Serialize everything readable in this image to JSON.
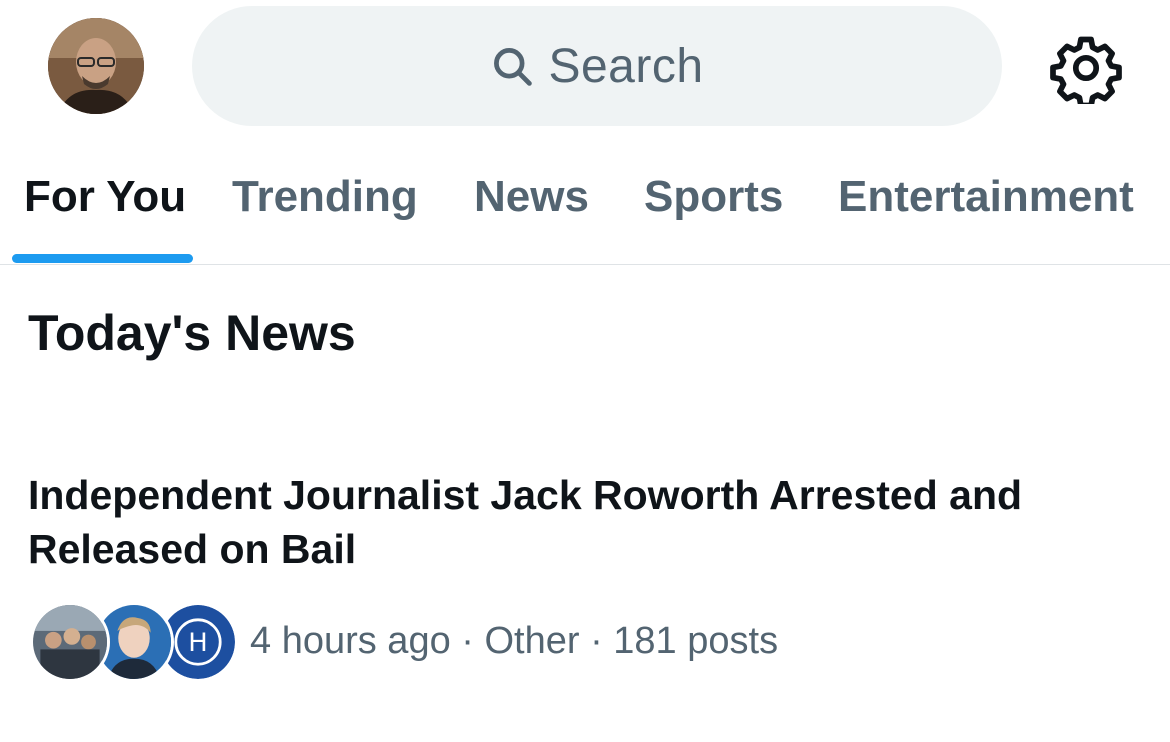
{
  "header": {
    "avatar_icon": "profile-avatar",
    "search": {
      "placeholder": "Search",
      "icon": "search-icon"
    },
    "settings_icon": "gear-icon"
  },
  "tabs": [
    {
      "label": "For You",
      "active": true
    },
    {
      "label": "Trending",
      "active": false
    },
    {
      "label": "News",
      "active": false
    },
    {
      "label": "Sports",
      "active": false
    },
    {
      "label": "Entertainment",
      "active": false
    }
  ],
  "section": {
    "title": "Today's News"
  },
  "news_item": {
    "headline": "Independent Journalist Jack Roworth Arrested and Released on Bail",
    "meta": "4 hours ago · Other · 181 posts",
    "avatars": [
      "group-photo-avatar",
      "man-portrait-avatar",
      "h-logo-avatar"
    ]
  },
  "colors": {
    "accent": "#1d9bf0",
    "text_primary": "#0f1419",
    "text_secondary": "#536471",
    "search_bg": "#eff3f4"
  }
}
